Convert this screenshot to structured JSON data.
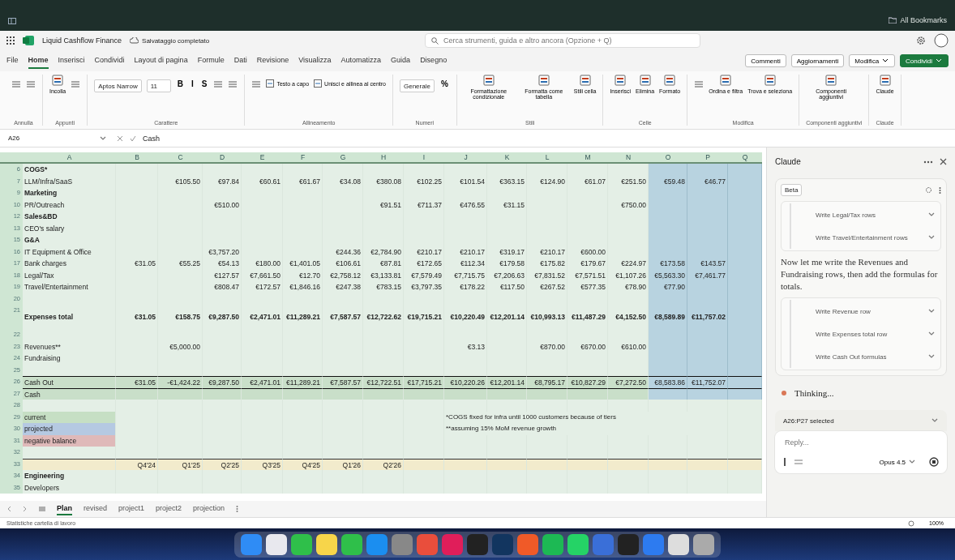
{
  "browser": {
    "bookmarks": "All Bookmarks"
  },
  "titlebar": {
    "title": "Liquid Cashflow Finance",
    "save_status": "Salvataggio completato",
    "search": {
      "placeholder": "Cerca strumenti, guida e altro ancora (Opzione + Q)"
    }
  },
  "menu": {
    "tabs": [
      {
        "label": "File",
        "selected": false
      },
      {
        "label": "Home",
        "selected": true
      },
      {
        "label": "Inserisci",
        "selected": false
      },
      {
        "label": "Condividi",
        "selected": false
      },
      {
        "label": "Layout di pagina",
        "selected": false
      },
      {
        "label": "Formule",
        "selected": false
      },
      {
        "label": "Dati",
        "selected": false
      },
      {
        "label": "Revisione",
        "selected": false
      },
      {
        "label": "Visualizza",
        "selected": false
      },
      {
        "label": "Automatizza",
        "selected": false
      },
      {
        "label": "Guida",
        "selected": false
      },
      {
        "label": "Disegno",
        "selected": false
      }
    ],
    "actions": [
      {
        "label": "Commenti",
        "kind": "plain"
      },
      {
        "label": "Aggiornamenti",
        "kind": "plain"
      },
      {
        "label": "Modifica",
        "kind": "dropdown"
      },
      {
        "label": "Condividi",
        "kind": "primary"
      }
    ]
  },
  "ribbon": [
    {
      "label": "Annulla",
      "items": [
        {
          "kind": "icon"
        },
        {
          "kind": "icon"
        }
      ]
    },
    {
      "label": "Appunti",
      "items": [
        {
          "kind": "big",
          "label": "Incolla"
        },
        {
          "kind": "icon"
        }
      ]
    },
    {
      "label": "Carattere",
      "items": [
        {
          "kind": "field",
          "label": "Aptos Narrow"
        },
        {
          "kind": "field",
          "label": "11"
        },
        {
          "kind": "glyph",
          "label": "B"
        },
        {
          "kind": "glyph",
          "label": "I"
        },
        {
          "kind": "glyph",
          "label": "S"
        },
        {
          "kind": "icon"
        },
        {
          "kind": "icon"
        }
      ]
    },
    {
      "label": "Allineamento",
      "items": [
        {
          "kind": "icon"
        },
        {
          "kind": "small",
          "label": "Testo a capo"
        },
        {
          "kind": "small",
          "label": "Unisci e allinea al centro"
        }
      ]
    },
    {
      "label": "Numeri",
      "items": [
        {
          "kind": "field",
          "label": "Generale"
        },
        {
          "kind": "glyph",
          "label": "%"
        }
      ]
    },
    {
      "label": "Stili",
      "items": [
        {
          "kind": "big",
          "label": "Formattazione condizionale"
        },
        {
          "kind": "big",
          "label": "Formatta come tabella"
        },
        {
          "kind": "big",
          "label": "Stili cella"
        }
      ]
    },
    {
      "label": "Celle",
      "items": [
        {
          "kind": "big",
          "label": "Inserisci"
        },
        {
          "kind": "big",
          "label": "Elimina"
        },
        {
          "kind": "big",
          "label": "Formato"
        }
      ]
    },
    {
      "label": "Modifica",
      "items": [
        {
          "kind": "icon"
        },
        {
          "kind": "big",
          "label": "Ordina e filtra"
        },
        {
          "kind": "big",
          "label": "Trova e seleziona"
        }
      ]
    },
    {
      "label": "Componenti aggiuntivi",
      "items": [
        {
          "kind": "big",
          "label": "Componenti aggiuntivi"
        }
      ]
    },
    {
      "label": "Claude",
      "items": [
        {
          "kind": "big",
          "label": "Claude"
        }
      ]
    }
  ],
  "formula_bar": {
    "cell": "A26",
    "value": "Cash"
  },
  "sheet": {
    "columns": [
      {
        "letter": "A",
        "projected": false
      },
      {
        "letter": "B",
        "projected": false
      },
      {
        "letter": "C",
        "projected": false
      },
      {
        "letter": "D",
        "projected": false
      },
      {
        "letter": "E",
        "projected": false
      },
      {
        "letter": "F",
        "projected": false
      },
      {
        "letter": "G",
        "projected": false
      },
      {
        "letter": "H",
        "projected": false
      },
      {
        "letter": "I",
        "projected": false
      },
      {
        "letter": "J",
        "projected": false
      },
      {
        "letter": "K",
        "projected": false
      },
      {
        "letter": "L",
        "projected": false
      },
      {
        "letter": "M",
        "projected": false
      },
      {
        "letter": "N",
        "projected": false
      },
      {
        "letter": "O",
        "projected": true
      },
      {
        "letter": "P",
        "projected": true
      },
      {
        "letter": "Q",
        "projected": true
      }
    ],
    "rows": [
      {
        "num": "6",
        "kind": "section",
        "cells": {
          "A": "COGS*"
        }
      },
      {
        "num": "7",
        "kind": "item",
        "cells": {
          "A": "LLM/Infra/SaaS",
          "C": "€105.50",
          "D": "€97.84",
          "E": "€60.61",
          "F": "€61.67",
          "G": "€34.08",
          "H": "€380.08",
          "I": "€102.25",
          "J": "€101.54",
          "K": "€363.15",
          "L": "€124.90",
          "M": "€61.07",
          "N": "€251.50",
          "O": "€59.48",
          "P": "€46.77"
        }
      },
      {
        "num": "9",
        "kind": "section",
        "cells": {
          "A": "Marketing"
        }
      },
      {
        "num": "10",
        "kind": "item",
        "cells": {
          "A": "PR/Outreach",
          "D": "€510.00",
          "H": "€91.51",
          "I": "€711.37",
          "J": "€476.55",
          "K": "€31.15",
          "N": "€750.00"
        }
      },
      {
        "num": "12",
        "kind": "section",
        "cells": {
          "A": "Sales&BD"
        }
      },
      {
        "num": "13",
        "kind": "plain",
        "cells": {
          "A": "CEO's salary"
        }
      },
      {
        "num": "15",
        "kind": "section",
        "cells": {
          "A": "G&A"
        }
      },
      {
        "num": "16",
        "kind": "item",
        "cells": {
          "A": "IT Equipment & Office",
          "D": "€3,757.20",
          "G": "€244.36",
          "H": "€2,784.90",
          "I": "€210.17",
          "J": "€210.17",
          "K": "€319.17",
          "L": "€210.17",
          "M": "€600.00"
        }
      },
      {
        "num": "17",
        "kind": "item",
        "cells": {
          "A": "Bank charges",
          "B": "€31.05",
          "C": "€55.25",
          "D": "€54.13",
          "E": "€180.00",
          "F": "€1,401.05",
          "G": "€106.61",
          "H": "€87.81",
          "I": "€172.65",
          "J": "€112.34",
          "K": "€179.58",
          "L": "€175.82",
          "M": "€179.67",
          "N": "€224.97",
          "O": "€173.58",
          "P": "€143.57"
        }
      },
      {
        "num": "18",
        "kind": "item",
        "cells": {
          "A": "Legal/Tax",
          "D": "€127.57",
          "E": "€7,661.50",
          "F": "€12.70",
          "G": "€2,758.12",
          "H": "€3,133.81",
          "I": "€7,579.49",
          "J": "€7,715.75",
          "K": "€7,206.63",
          "L": "€7,831.52",
          "M": "€7,571.51",
          "N": "€1,107.26",
          "O": "€5,563.30",
          "P": "€7,461.77"
        }
      },
      {
        "num": "19",
        "kind": "item",
        "cells": {
          "A": "Travel/Entertainment",
          "D": "€808.47",
          "E": "€172.57",
          "F": "€1,846.16",
          "G": "€247.38",
          "H": "€783.15",
          "I": "€3,797.35",
          "J": "€178.22",
          "K": "€117.50",
          "L": "€267.52",
          "M": "€577.35",
          "N": "€78.90",
          "O": "€77.90"
        }
      },
      {
        "num": "20",
        "kind": "blank",
        "cells": {}
      },
      {
        "num": "21",
        "kind": "total",
        "cells": {
          "A": "Expenses total",
          "B": "€31.05",
          "C": "€158.75",
          "D": "€9,287.50",
          "E": "€2,471.01",
          "F": "€11,289.21",
          "G": "€7,587.57",
          "H": "€12,722.62",
          "I": "€19,715.21",
          "J": "€10,220.49",
          "K": "€12,201.14",
          "L": "€10,993.13",
          "M": "€11,487.29",
          "N": "€4,152.50",
          "O": "€8,589.89",
          "P": "€11,757.02"
        }
      },
      {
        "num": "22",
        "kind": "blank",
        "cells": {}
      },
      {
        "num": "23",
        "kind": "item",
        "cells": {
          "A": "Revenues**",
          "C": "€5,000.00",
          "J": "€3.13",
          "L": "€870.00",
          "M": "€670.00",
          "N": "€610.00"
        }
      },
      {
        "num": "24",
        "kind": "plain",
        "cells": {
          "A": "Fundraising"
        }
      },
      {
        "num": "25",
        "kind": "blank",
        "cells": {}
      },
      {
        "num": "26",
        "kind": "cash",
        "cells": {
          "A": "Cash Out",
          "B": "€31.05",
          "C": "-€1,424.22",
          "D": "€9,287.50",
          "E": "€2,471.01",
          "F": "€11,289.21",
          "G": "€7,587.57",
          "H": "€12,722.51",
          "I": "€17,715.21",
          "J": "€10,220.26",
          "K": "€12,201.14",
          "L": "€8,795.17",
          "M": "€10,827.29",
          "N": "€7,272.50",
          "O": "€8,583.86",
          "P": "€11,752.07"
        }
      },
      {
        "num": "27",
        "kind": "cash",
        "cells": {
          "A": "Cash"
        }
      },
      {
        "num": "28",
        "kind": "gap",
        "cells": {}
      },
      {
        "num": "29",
        "kind": "legend",
        "color": "#c6dfc4",
        "cells": {
          "A": "current"
        },
        "note": "*COGS fixed for infra until 1000 customers because of tiers"
      },
      {
        "num": "30",
        "kind": "legend",
        "color": "#b5c9e2",
        "cells": {
          "A": "projected"
        },
        "note": "**assuming 15% MoM revenue growth"
      },
      {
        "num": "31",
        "kind": "legend",
        "color": "#dfb9b9",
        "cells": {
          "A": "negative balance"
        }
      },
      {
        "num": "32",
        "kind": "gap",
        "cells": {}
      },
      {
        "num": "33",
        "kind": "header",
        "cells": {
          "B": "Q4'24",
          "C": "Q1'25",
          "D": "Q2'25",
          "E": "Q3'25",
          "F": "Q4'25",
          "G": "Q1'26",
          "H": "Q2'26"
        }
      },
      {
        "num": "34",
        "kind": "subsection",
        "cells": {
          "A": "Engineering"
        }
      },
      {
        "num": "35",
        "kind": "subitem",
        "cells": {
          "A": "Developers"
        }
      }
    ],
    "tabs": [
      {
        "label": "Plan",
        "selected": true
      },
      {
        "label": "revised",
        "selected": false
      },
      {
        "label": "project1",
        "selected": false
      },
      {
        "label": "project2",
        "selected": false
      },
      {
        "label": "projection",
        "selected": false
      }
    ]
  },
  "sidebar": {
    "title": "Claude",
    "badge": "Beta",
    "messages": [
      {
        "kind": "steps",
        "steps": [
          "Write Legal/Tax rows",
          "Write Travel/Entertainment rows"
        ]
      },
      {
        "kind": "text",
        "text": "Now let me write the Revenues and Fundraising rows, then add the formulas for totals."
      },
      {
        "kind": "steps",
        "steps": [
          "Write Revenue row",
          "Write Expenses total row",
          "Write Cash Out formulas"
        ]
      }
    ],
    "status": "Thinking...",
    "selection": "A26:P27 selected",
    "input": {
      "placeholder": "Reply..."
    },
    "model": "Opus 4.5"
  },
  "status_bar": {
    "text": "Statistiche cartella di lavoro",
    "zoom": "100%"
  }
}
